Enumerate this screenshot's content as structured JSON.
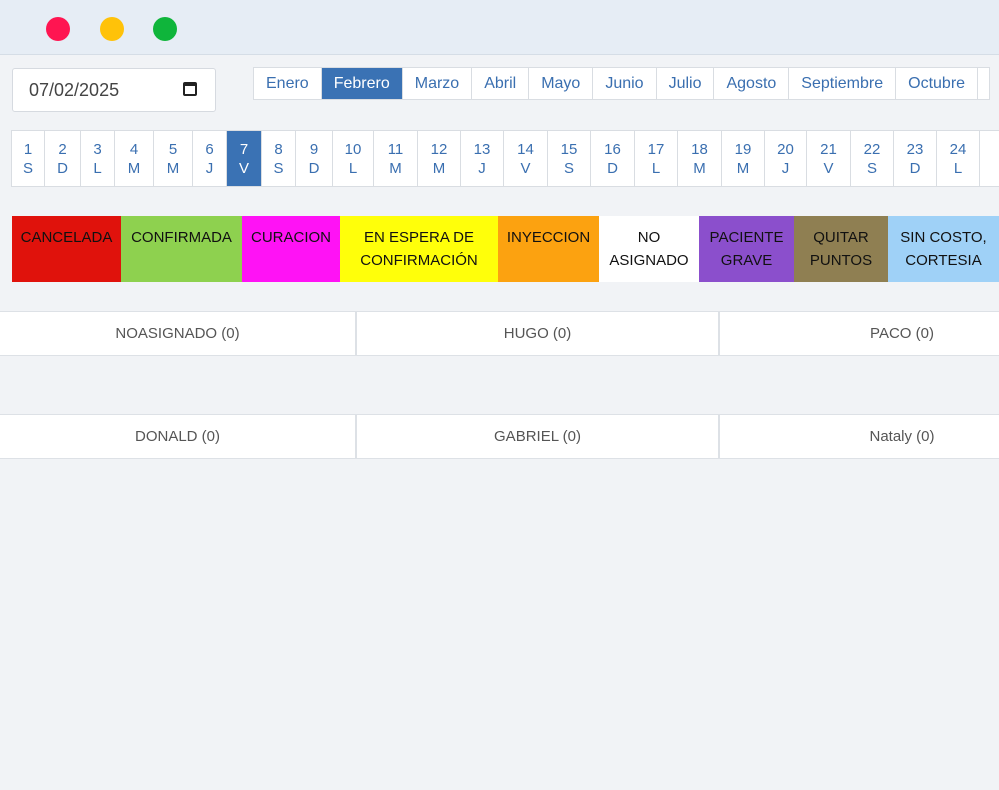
{
  "date_input": {
    "value": "07/02/2025"
  },
  "months": [
    "Enero",
    "Febrero",
    "Marzo",
    "Abril",
    "Mayo",
    "Junio",
    "Julio",
    "Agosto",
    "Septiembre",
    "Octubre"
  ],
  "active_month": "Febrero",
  "days": [
    {
      "n": "1",
      "d": "S"
    },
    {
      "n": "2",
      "d": "D"
    },
    {
      "n": "3",
      "d": "L"
    },
    {
      "n": "4",
      "d": "M"
    },
    {
      "n": "5",
      "d": "M"
    },
    {
      "n": "6",
      "d": "J"
    },
    {
      "n": "7",
      "d": "V"
    },
    {
      "n": "8",
      "d": "S"
    },
    {
      "n": "9",
      "d": "D"
    },
    {
      "n": "10",
      "d": "L"
    },
    {
      "n": "11",
      "d": "M"
    },
    {
      "n": "12",
      "d": "M"
    },
    {
      "n": "13",
      "d": "J"
    },
    {
      "n": "14",
      "d": "V"
    },
    {
      "n": "15",
      "d": "S"
    },
    {
      "n": "16",
      "d": "D"
    },
    {
      "n": "17",
      "d": "L"
    },
    {
      "n": "18",
      "d": "M"
    },
    {
      "n": "19",
      "d": "M"
    },
    {
      "n": "20",
      "d": "J"
    },
    {
      "n": "21",
      "d": "V"
    },
    {
      "n": "22",
      "d": "S"
    },
    {
      "n": "23",
      "d": "D"
    },
    {
      "n": "24",
      "d": "L"
    }
  ],
  "active_day": "7",
  "legend": [
    {
      "label": "CANCELADA",
      "color": "#e0120c"
    },
    {
      "label": "CONFIRMADA",
      "color": "#8ed14f"
    },
    {
      "label": "CURACION",
      "color": "#ff12f5"
    },
    {
      "label": "EN ESPERA DE\nCONFIRMACIÓN",
      "color": "#ffff0a"
    },
    {
      "label": "INYECCION",
      "color": "#fca210"
    },
    {
      "label": "NO\nASIGNADO",
      "color": "#ffffff"
    },
    {
      "label": "PACIENTE\nGRAVE",
      "color": "#8b4fcc"
    },
    {
      "label": "QUITAR\nPUNTOS",
      "color": "#8f7f52"
    },
    {
      "label": "SIN COSTO,\nCORTESIA",
      "color": "#9fd1f7"
    }
  ],
  "doctor_rows": [
    [
      "NOASIGNADO (0)",
      "HUGO (0)",
      "PACO (0)"
    ],
    [
      "DONALD (0)",
      "GABRIEL (0)",
      "Nataly (0)"
    ]
  ]
}
